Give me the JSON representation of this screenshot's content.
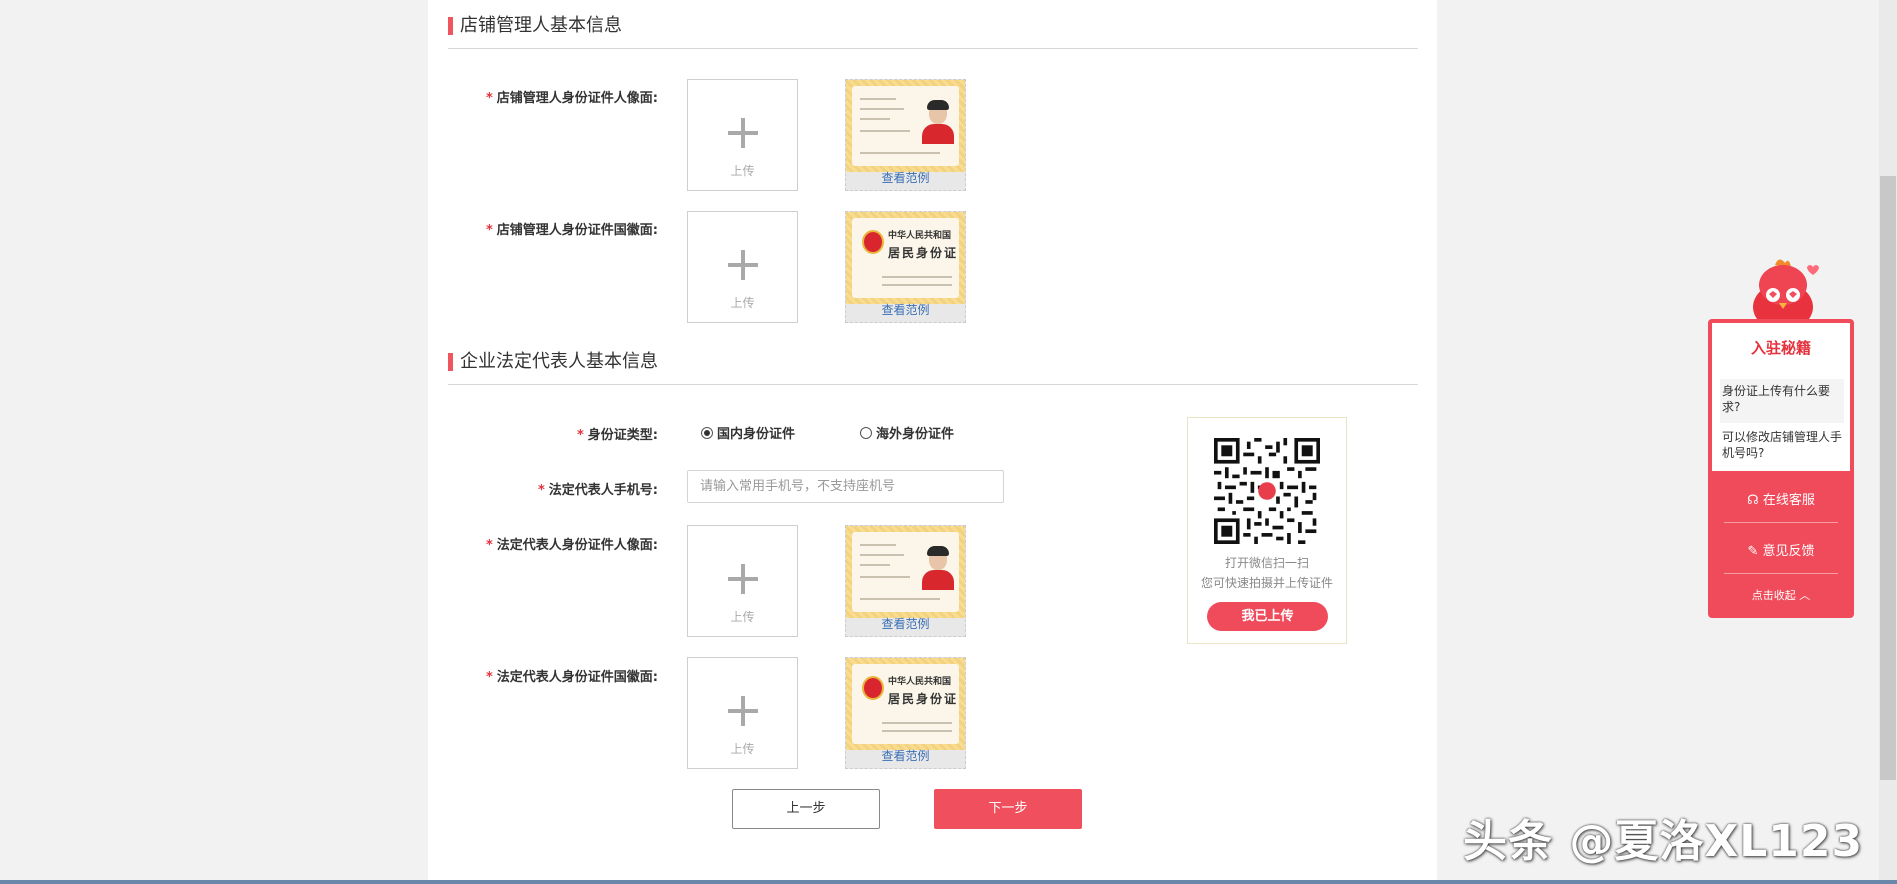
{
  "section1": {
    "title": "店铺管理人基本信息"
  },
  "section2": {
    "title": "企业法定代表人基本信息"
  },
  "fields": {
    "manager_front": {
      "label": "店铺管理人身份证件人像面:",
      "upload_text": "上传",
      "sample_link": "查看范例"
    },
    "manager_back": {
      "label": "店铺管理人身份证件国徽面:",
      "upload_text": "上传",
      "sample_link": "查看范例"
    },
    "id_type": {
      "label": "身份证类型:",
      "options": [
        "国内身份证件",
        "海外身份证件"
      ],
      "selected": "国内身份证件"
    },
    "phone": {
      "label": "法定代表人手机号:",
      "placeholder": "请输入常用手机号，不支持座机号",
      "value": ""
    },
    "legal_front": {
      "label": "法定代表人身份证件人像面:",
      "upload_text": "上传",
      "sample_link": "查看范例"
    },
    "legal_back": {
      "label": "法定代表人身份证件国徽面:",
      "upload_text": "上传",
      "sample_link": "查看范例"
    }
  },
  "required_mark": "*",
  "id_card_back_sample": {
    "line1": "中华人民共和国",
    "line2": "居民身份证"
  },
  "qr_panel": {
    "line1": "打开微信扫一扫",
    "line2": "您可快速拍摄并上传证件",
    "button": "我已上传"
  },
  "buttons": {
    "prev": "上一步",
    "next": "下一步"
  },
  "widget": {
    "title": "入驻秘籍",
    "questions": [
      "身份证上传有什么要求?",
      "可以修改店铺管理人手机号吗?"
    ],
    "online_service": "在线客服",
    "feedback": "意见反馈",
    "collapse": "点击收起"
  },
  "watermark": "头条 @夏洛XL123",
  "colors": {
    "accent": "#f0505e",
    "link": "#3b6fb6",
    "required": "#e5323d"
  }
}
